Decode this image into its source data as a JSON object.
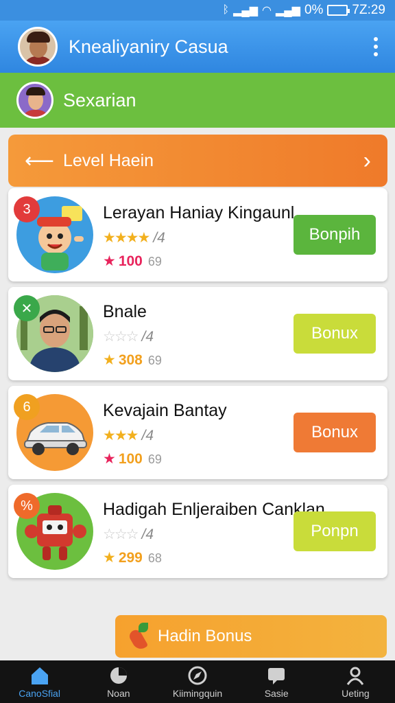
{
  "status_bar": {
    "bt_icon": "bluetooth-icon",
    "battery": "0%",
    "time": "7Z:29"
  },
  "app_bar": {
    "title": "Knealiyaniry Casua",
    "avatar_icon": "avatar-icon",
    "more_icon": "more-vert-icon"
  },
  "sub_bar": {
    "title": "Sexarian"
  },
  "level_header": {
    "title": "Level Haein",
    "back_icon": "arrow-left-icon",
    "next_icon": "chevron-right-icon"
  },
  "cards": [
    {
      "badge": "3",
      "badge_color": "#e23b3b",
      "title": "Lerayan Haniay Kingaunl",
      "stars": "★★★★",
      "stars_empty": "",
      "rating_count": "/4",
      "score_star": "★",
      "score_star_color": "#e8245c",
      "score": "100",
      "score_color": "#e8245c",
      "score_extra": "69",
      "action": "Bonpih",
      "action_color": "#5bb53d"
    },
    {
      "badge": "✕",
      "badge_color": "#3aa84a",
      "title": "Bnale",
      "stars": "",
      "stars_empty": "☆☆☆",
      "rating_count": "/4",
      "score_star": "★",
      "score_star_color": "#f2b01e",
      "score": "308",
      "score_color": "#f2a01e",
      "score_extra": "69",
      "action": "Bonux",
      "action_color": "#c9dc3a"
    },
    {
      "badge": "6",
      "badge_color": "#f0a020",
      "title": "Kevajain Bantay",
      "stars": "★★★",
      "stars_empty": "",
      "rating_count": "/4",
      "score_star": "★",
      "score_star_color": "#e8245c",
      "score": "100",
      "score_color": "#f2a01e",
      "score_extra": "69",
      "action": "Bonux",
      "action_color": "#ef7a35"
    },
    {
      "badge": "%",
      "badge_color": "#ef6a2a",
      "title": "Hadigah Enljeraiben Canklan",
      "stars": "",
      "stars_empty": "☆☆☆",
      "rating_count": "/4",
      "score_star": "★",
      "score_star_color": "#f2b01e",
      "score": "299",
      "score_color": "#f2a01e",
      "score_extra": "68",
      "action": "Ponpn",
      "action_color": "#c9dc3a"
    }
  ],
  "bonus_button": {
    "label": "Hadin Bonus"
  },
  "bottom_nav": [
    {
      "label": "CanoSfial",
      "icon": "home-icon"
    },
    {
      "label": "Noan",
      "icon": "pie-chart-icon"
    },
    {
      "label": "Kiimingquin",
      "icon": "compass-icon"
    },
    {
      "label": "Sasie",
      "icon": "message-icon"
    },
    {
      "label": "Ueting",
      "icon": "user-icon"
    }
  ]
}
